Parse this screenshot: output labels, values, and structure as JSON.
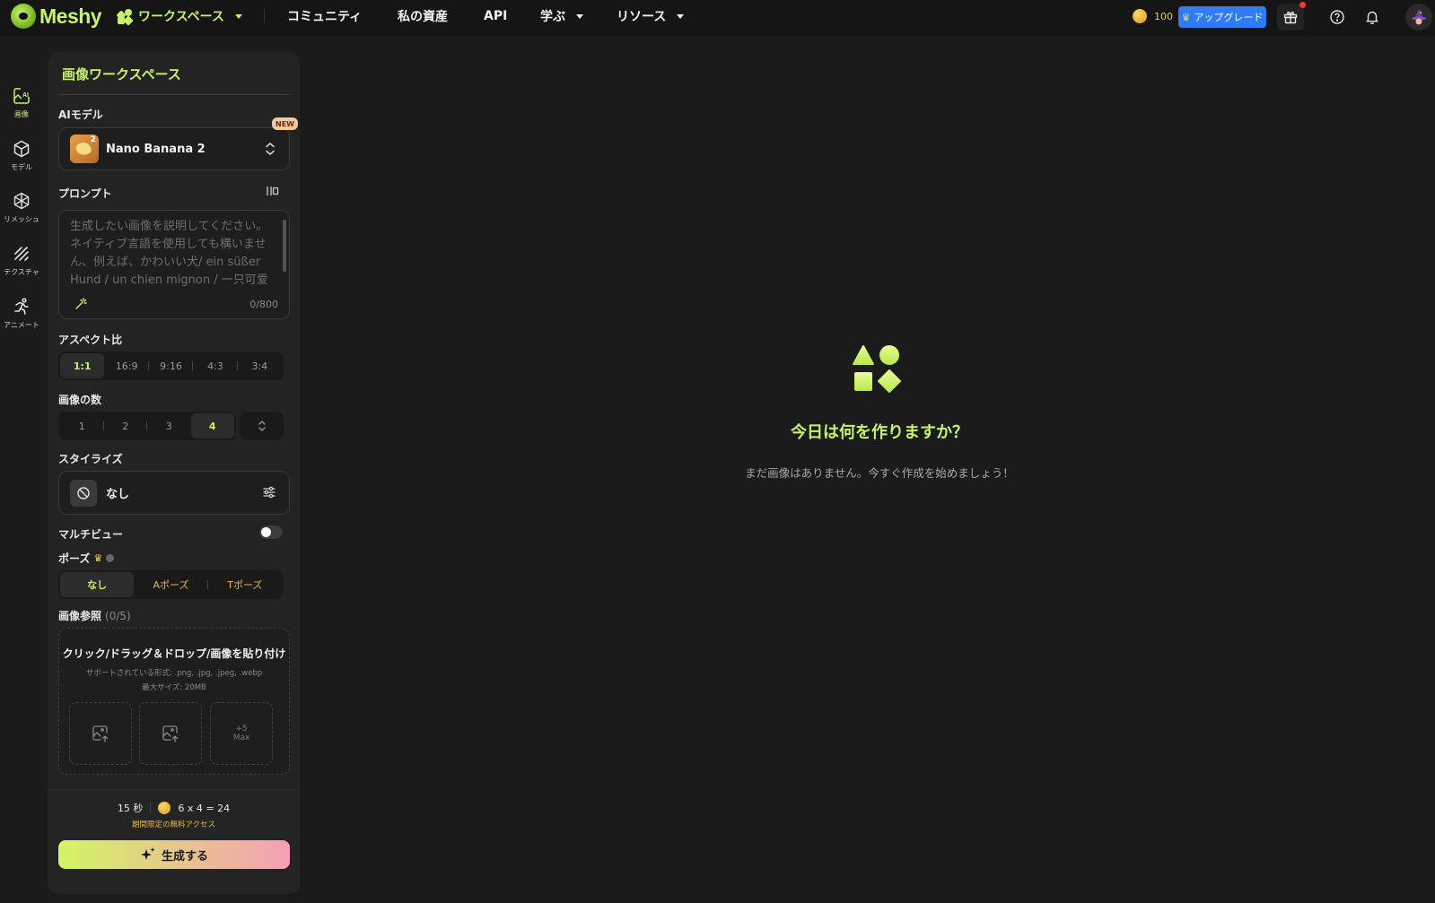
{
  "brand": {
    "name": "Meshy"
  },
  "nav": {
    "workspace": "ワークスペース",
    "community": "コミュニティ",
    "assets": "私の資産",
    "api": "API",
    "learn": "学ぶ",
    "resources": "リソース"
  },
  "header": {
    "credits": "100",
    "upgrade": "アップグレード"
  },
  "rail": [
    {
      "label": "画像",
      "icon": "image-ai-icon",
      "active": true
    },
    {
      "label": "モデル",
      "icon": "cube-icon",
      "active": false
    },
    {
      "label": "リメッシュ",
      "icon": "remesh-icon",
      "active": false
    },
    {
      "label": "テクスチャ",
      "icon": "texture-icon",
      "active": false
    },
    {
      "label": "アニメート",
      "icon": "running-figure-icon",
      "active": false
    }
  ],
  "panel": {
    "title": "画像ワークスペース",
    "model": {
      "label": "AIモデル",
      "name": "Nano Banana 2",
      "badge": "NEW",
      "thumb_num": "2"
    },
    "prompt": {
      "label": "プロンプト",
      "placeholder": "生成したい画像を説明してください。ネイティブ言語を使用しても構いません、例えば、かわいい犬/ ein süßer Hund / un chien mignon / 一只可爱的小狗 / かわいい",
      "count": "0/800"
    },
    "aspect": {
      "label": "アスペクト比",
      "options": [
        "1:1",
        "16:9",
        "9:16",
        "4:3",
        "3:4"
      ],
      "selected": "1:1"
    },
    "count": {
      "label": "画像の数",
      "options": [
        "1",
        "2",
        "3",
        "4"
      ],
      "selected": "4"
    },
    "stylize": {
      "label": "スタイライズ",
      "value": "なし"
    },
    "multiview": {
      "label": "マルチビュー",
      "enabled": false
    },
    "pose": {
      "label": "ポーズ",
      "options": [
        "なし",
        "Aポーズ",
        "Tポーズ"
      ],
      "selected": "なし"
    },
    "reference": {
      "label": "画像参照",
      "count": "(0/5)",
      "title": "クリック/ドラッグ＆ドロップ/画像を貼り付け",
      "formats": "サポートされている形式: .png, .jpg, .jpeg, .webp",
      "maxsize": "最大サイズ: 20MB",
      "more_line1": "+5",
      "more_line2": "Max"
    },
    "footer": {
      "time": "15 秒",
      "cost": "6 x 4 = 24",
      "promo": "期間限定の無料アクセス",
      "generate": "生成する"
    }
  },
  "main": {
    "title": "今日は何を作りますか？",
    "subtitle": "まだ画像はありません。今すぐ作成を始めましょう！"
  },
  "colors": {
    "accent": "#c6f36a",
    "upgrade_blue": "#2f7cf6",
    "gold": "#e8b84a",
    "background": "#1b1b1b",
    "panel": "#232323"
  }
}
